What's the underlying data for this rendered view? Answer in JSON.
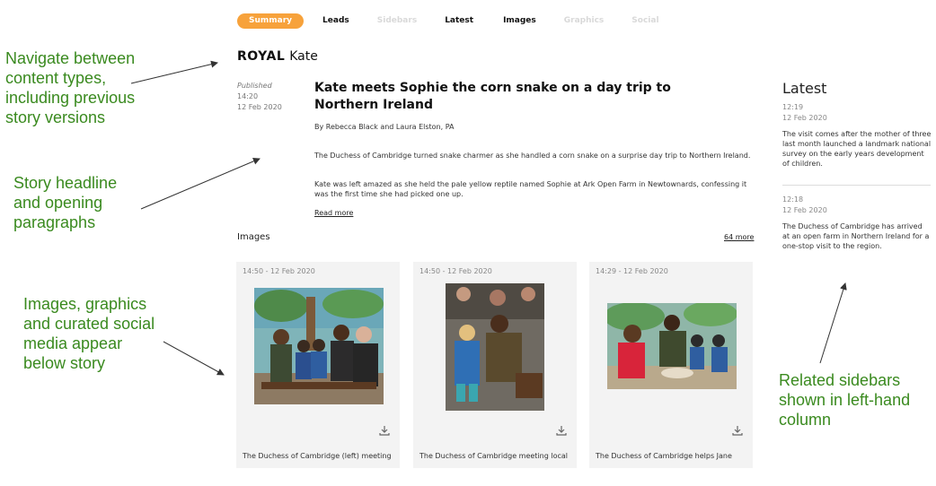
{
  "annotations": [
    "Navigate between\ncontent types,\nincluding previous\nstory versions",
    "Story headline\nand opening\nparagraphs",
    "Images, graphics\nand curated social\nmedia appear\nbelow story",
    "Related sidebars\nshown in left-hand\ncolumn"
  ],
  "tabs": [
    {
      "label": "Summary",
      "state": "active"
    },
    {
      "label": "Leads",
      "state": "enabled"
    },
    {
      "label": "Sidebars",
      "state": "disabled"
    },
    {
      "label": "Latest",
      "state": "enabled"
    },
    {
      "label": "Images",
      "state": "enabled"
    },
    {
      "label": "Graphics",
      "state": "disabled"
    },
    {
      "label": "Social",
      "state": "disabled"
    }
  ],
  "story": {
    "kicker": "ROYAL",
    "topic": "Kate",
    "published_label": "Published",
    "published_time": "14:20",
    "published_date": "12 Feb 2020",
    "headline": "Kate meets Sophie the corn snake on a day trip to Northern Ireland",
    "byline": "By Rebecca Black and Laura Elston, PA",
    "paragraphs": [
      "The Duchess of Cambridge turned snake charmer as she handled a corn snake on a surprise day trip to Northern Ireland.",
      "Kate was left amazed as she held the pale yellow reptile named Sophie at Ark Open Farm in Newtownards, confessing it was the first time she had picked one up."
    ],
    "read_more": "Read more"
  },
  "images": {
    "title": "Images",
    "more_link": "64 more",
    "cards": [
      {
        "timestamp": "14:50 - 12 Feb 2020",
        "caption": "The Duchess of Cambridge (left) meeting"
      },
      {
        "timestamp": "14:50 - 12 Feb 2020",
        "caption": "The Duchess of Cambridge meeting local"
      },
      {
        "timestamp": "14:29 - 12 Feb 2020",
        "caption": "The Duchess of Cambridge helps Jane"
      }
    ]
  },
  "latest": {
    "title": "Latest",
    "items": [
      {
        "time": "12:19",
        "date": "12 Feb 2020",
        "text": "The visit comes after the mother of three last month launched a landmark national survey on the early years development of children."
      },
      {
        "time": "12:18",
        "date": "12 Feb 2020",
        "text": "The Duchess of Cambridge has arrived at an open farm in Northern Ireland for a one-stop visit to the region."
      }
    ]
  },
  "colors": {
    "accent": "#f7a23b",
    "annotation": "#3a8a1f",
    "card_bg": "#f3f3f3"
  },
  "icons": {
    "download": "download-icon"
  }
}
